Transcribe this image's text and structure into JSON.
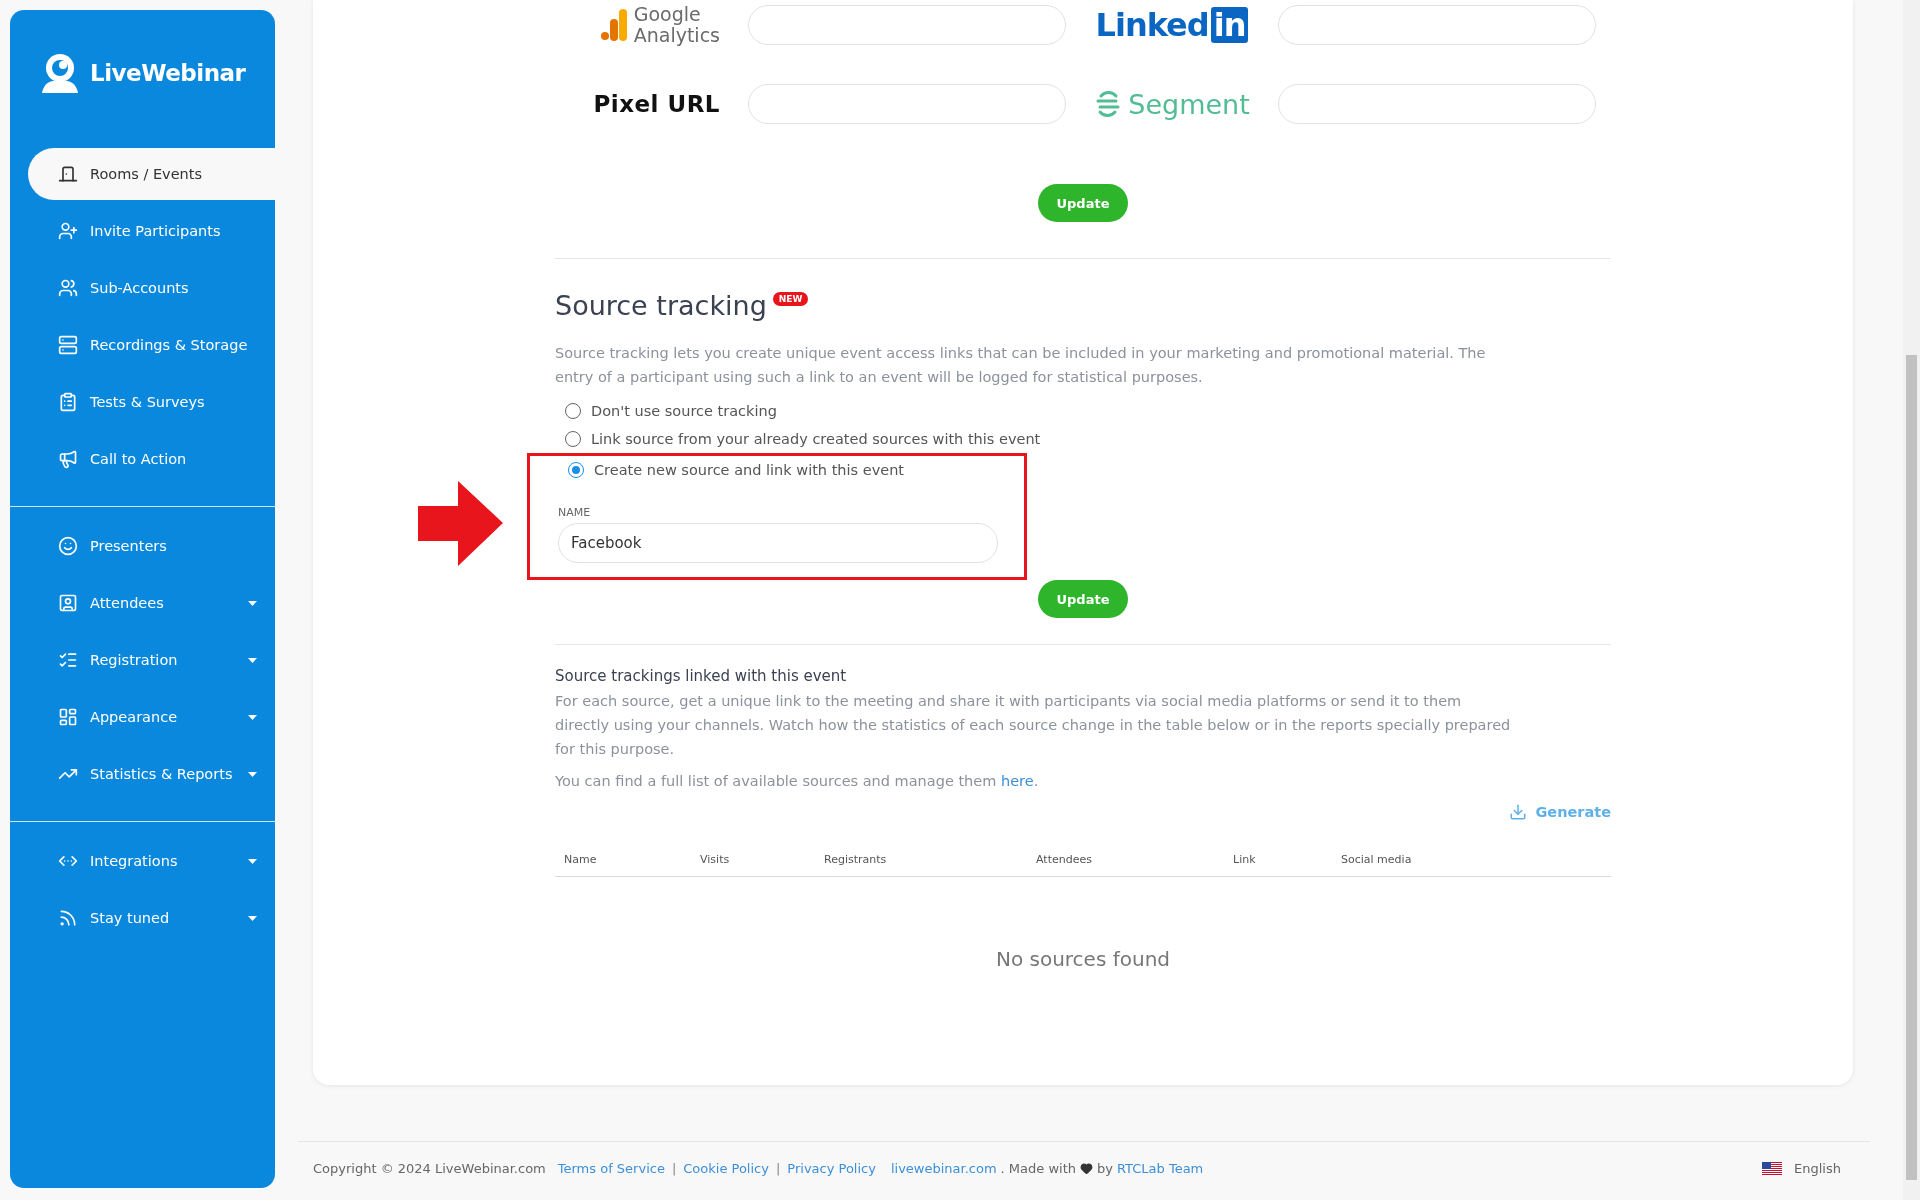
{
  "sidebar": {
    "logo": "LiveWebinar",
    "groups": [
      {
        "items": [
          {
            "label": "Rooms / Events",
            "selected": true,
            "has_menu": false
          },
          {
            "label": "Invite Participants",
            "selected": false,
            "has_menu": false
          },
          {
            "label": "Sub-Accounts",
            "selected": false,
            "has_menu": false
          },
          {
            "label": "Recordings & Storage",
            "selected": false,
            "has_menu": false
          },
          {
            "label": "Tests & Surveys",
            "selected": false,
            "has_menu": false
          },
          {
            "label": "Call to Action",
            "selected": false,
            "has_menu": false
          }
        ]
      },
      {
        "items": [
          {
            "label": "Presenters",
            "selected": false,
            "has_menu": false
          },
          {
            "label": "Attendees",
            "selected": false,
            "has_menu": true
          },
          {
            "label": "Registration",
            "selected": false,
            "has_menu": true
          },
          {
            "label": "Appearance",
            "selected": false,
            "has_menu": true
          },
          {
            "label": "Statistics & Reports",
            "selected": false,
            "has_menu": true
          }
        ]
      },
      {
        "items": [
          {
            "label": "Integrations",
            "selected": false,
            "has_menu": true
          },
          {
            "label": "Stay tuned",
            "selected": false,
            "has_menu": true
          }
        ]
      }
    ]
  },
  "tracking": {
    "integrations": [
      {
        "kind": "google-analytics",
        "logo_lines": [
          "Google",
          "Analytics"
        ]
      },
      {
        "kind": "linkedin",
        "logo": "Linked",
        "logo_box": "in"
      },
      {
        "kind": "pixel",
        "label": "Pixel URL"
      },
      {
        "kind": "segment",
        "logo": "Segment"
      }
    ],
    "button": "Update"
  },
  "source_tracking": {
    "title": "Source tracking",
    "badge": "NEW",
    "description": "Source tracking lets you create unique event access links that can be included in your marketing and promotional material. The entry of a participant using such a link to an event will be logged for statistical purposes.",
    "options": [
      {
        "label": "Don't use source tracking",
        "selected": false
      },
      {
        "label": "Link source from your already created sources with this event",
        "selected": false
      },
      {
        "label": "Create new source and link with this event",
        "selected": true
      }
    ],
    "highlighted": true,
    "name_field": {
      "label": "NAME",
      "value": "Facebook"
    },
    "button": "Update"
  },
  "linked": {
    "title": "Source trackings linked with this event",
    "description": "For each source, get a unique link to the meeting and share it with participants via social media platforms or send it to them directly using your channels. Watch how the statistics of each source change in the table below or in the reports specially prepared for this purpose.",
    "note_before": "You can find a full list of available sources and manage them ",
    "note_link": "here",
    "note_after": ".",
    "generate": "Generate",
    "columns": [
      "Name",
      "Visits",
      "Registrants",
      "Attendees",
      "Link",
      "Social media"
    ],
    "empty": "No sources found"
  },
  "footer": {
    "copyright": "Copyright © 2024 LiveWebinar.com",
    "links": [
      "Terms of Service",
      "Cookie Policy",
      "Privacy Policy"
    ],
    "separator": "|",
    "site_link": "livewebinar.com",
    "made_with": ". Made with",
    "by": "by",
    "team_link": "RTCLab Team",
    "language": "English"
  }
}
